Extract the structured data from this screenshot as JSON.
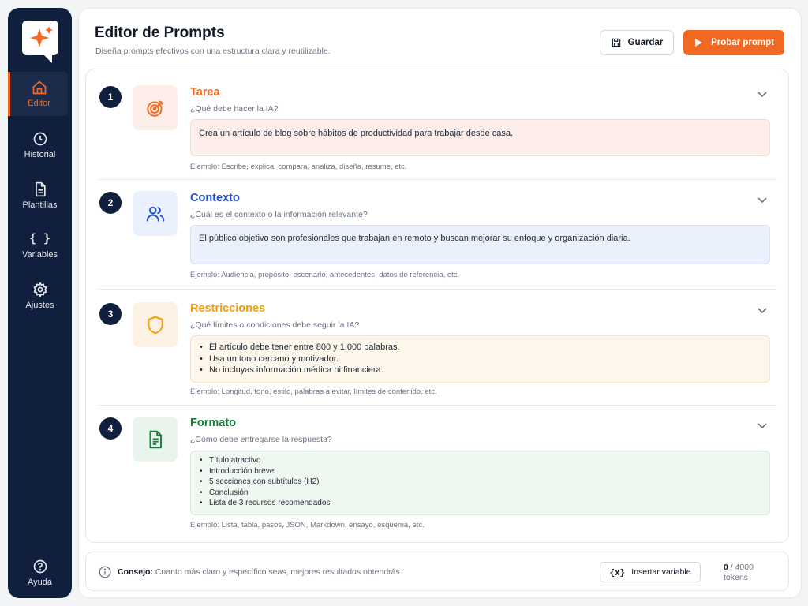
{
  "sidebar": {
    "items": [
      {
        "label": "Editor",
        "icon": "home-icon",
        "active": true
      },
      {
        "label": "Historial",
        "icon": "clock-icon"
      },
      {
        "label": "Plantillas",
        "icon": "document-icon"
      },
      {
        "label": "Variables",
        "icon": "braces-icon",
        "glyph": "{ }"
      },
      {
        "label": "Ajustes",
        "icon": "gear-icon"
      }
    ],
    "help_label": "Ayuda"
  },
  "header": {
    "title": "Editor de Prompts",
    "subtitle": "Diseña prompts efectivos con una estructura clara y reutilizable.",
    "save_label": "Guardar",
    "test_label": "Probar prompt"
  },
  "sections": [
    {
      "number": "1",
      "title": "Tarea",
      "question": "¿Qué debe hacer la IA?",
      "content": "Crea un artículo de blog sobre hábitos de productividad para trabajar desde casa.",
      "example": "Ejemplo: Escribe, explica, compara, analiza, diseña, resume, etc.",
      "accent": "#f26a21",
      "icon": "target-icon"
    },
    {
      "number": "2",
      "title": "Contexto",
      "question": "¿Cuál es el contexto o la información relevante?",
      "content": "El público objetivo son profesionales que trabajan en remoto y buscan mejorar su enfoque y organización diaria.",
      "example": "Ejemplo: Audiencia, propósito, escenario, antecedentes, datos de referencia, etc.",
      "accent": "#1d4ed8",
      "icon": "users-icon"
    },
    {
      "number": "3",
      "title": "Restricciones",
      "question": "¿Qué límites o condiciones debe seguir la IA?",
      "bullets": [
        "El artículo debe tener entre 800 y 1.000 palabras.",
        "Usa un tono cercano y motivador.",
        "No incluyas información médica ni financiera."
      ],
      "example": "Ejemplo: Longitud, tono, estilo, palabras a evitar, límites de contenido, etc.",
      "accent": "#f59e0b",
      "icon": "shield-icon"
    },
    {
      "number": "4",
      "title": "Formato",
      "question": "¿Cómo debe entregarse la respuesta?",
      "bullets": [
        "Título atractivo",
        "Introducción breve",
        "5 secciones con subtítulos (H2)",
        "Conclusión",
        "Lista de 3 recursos recomendados"
      ],
      "example": "Ejemplo: Lista, tabla, pasos, JSON, Markdown, ensayo, esquema, etc.",
      "accent": "#15803d",
      "icon": "file-text-icon"
    }
  ],
  "footer": {
    "tip_label": "Consejo:",
    "tip_text": " Cuanto más claro y específico seas, mejores resultados obtendrás.",
    "insert_icon": "{x}",
    "insert_label": "Insertar variable",
    "token_count": "0",
    "token_limit": " / 4000",
    "token_unit": "tokens"
  },
  "colors": {
    "sidebar_bg": "#0f1f3d",
    "brand_orange": "#f26a21",
    "tarea_bg": "#fdeee9",
    "contexto_bg": "#ebf1fc",
    "restricciones_bg": "#fdf1e3",
    "formato_bg": "#e9f5ec"
  }
}
